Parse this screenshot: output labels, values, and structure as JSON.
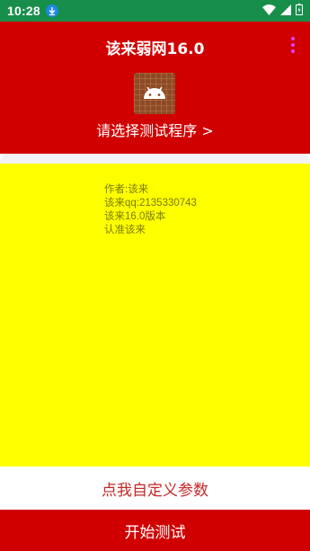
{
  "status_bar": {
    "time": "10:28",
    "icons": [
      "download-icon",
      "wifi-icon",
      "signal-icon",
      "battery-icon"
    ]
  },
  "header": {
    "title": "该来弱网16.0",
    "select_program_label": "请选择测试程序 >",
    "overflow_icon": "more-vert-icon",
    "app_icon": "android-icon"
  },
  "log": {
    "lines": [
      "作者:该来",
      "该来qq:2135330743",
      "该来16.0版本",
      "认准该来"
    ]
  },
  "buttons": {
    "custom_params_label": "点我自定义参数",
    "start_test_label": "开始测试"
  },
  "colors": {
    "status_bar": "#178e4a",
    "header_bg": "#d10000",
    "log_bg": "#ffff00",
    "custom_text": "#c62828",
    "menu_dots": "#e040fb"
  }
}
